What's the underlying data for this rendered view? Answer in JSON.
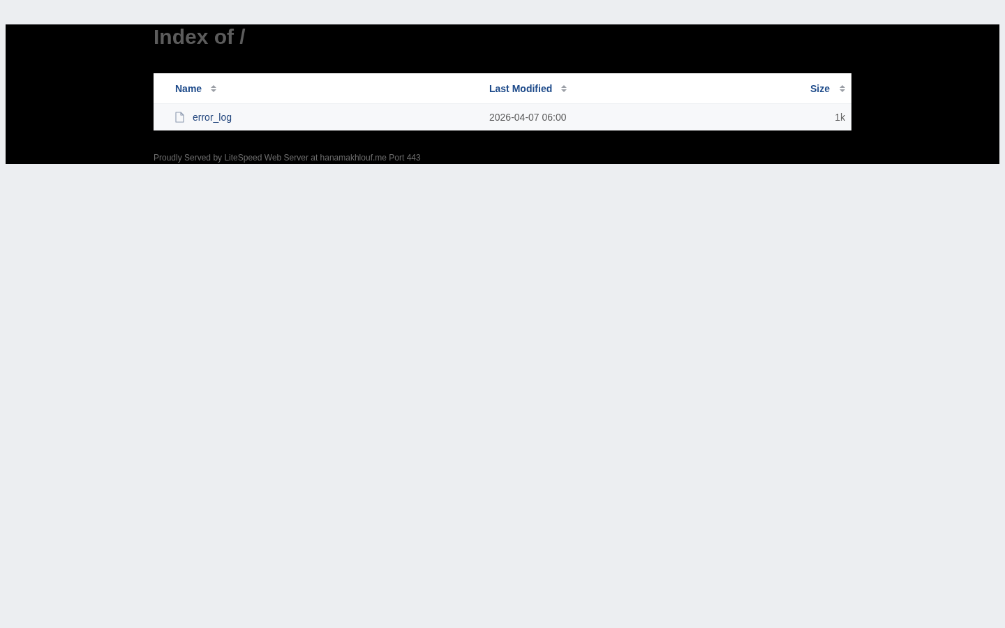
{
  "title": "Index of /",
  "table": {
    "columns": [
      {
        "label": "Name"
      },
      {
        "label": "Last Modified"
      },
      {
        "label": "Size"
      }
    ],
    "rows": [
      {
        "kind": "file",
        "name": "error_log",
        "modified": "2026-04-07 06:00",
        "size": "1k"
      }
    ]
  },
  "footer": "Proudly Served by LiteSpeed Web Server at hanamakhlouf.me Port 443"
}
